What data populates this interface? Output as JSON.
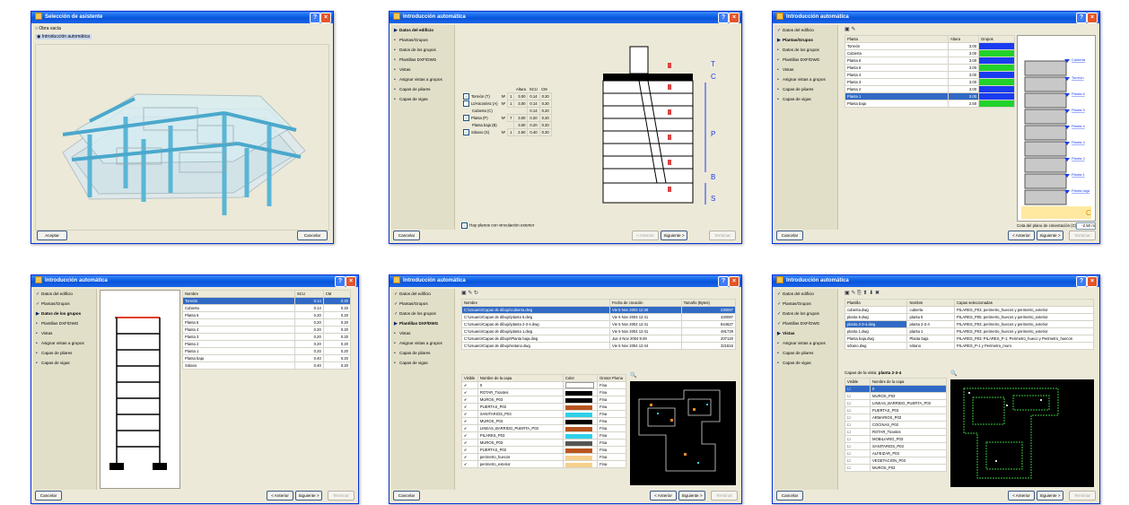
{
  "win1": {
    "title": "Selección de asistente",
    "options": [
      "Obra vacía",
      "Introducción automática"
    ],
    "btn_left": "Aceptar",
    "btn_right": "Cancelar"
  },
  "sidebar": [
    "Datos del edificio",
    "Plantas/Grupos",
    "Datos de los grupos",
    "Plantillas DXF/DWG",
    "Vistas",
    "Asignar vistas a grupos",
    "Capas de pilares",
    "Capas de vigas"
  ],
  "w2": {
    "title": "Introducción automática",
    "hdr": [
      "Altura",
      "SCU",
      "CM"
    ],
    "rows": [
      {
        "label": "Torreón (T)",
        "n": "Nº",
        "v": [
          "1",
          "3.00",
          "0.14",
          "0.20"
        ],
        "checked": true
      },
      {
        "label": "Lt/Aticos/etc (A)",
        "n": "Nº",
        "v": [
          "1",
          "3.00",
          "0.14",
          "0.20"
        ],
        "checked": false
      },
      {
        "label": "Cubierta (C)",
        "n": "",
        "v": [
          "",
          "",
          "0.14",
          "0.20"
        ],
        "checked": null
      },
      {
        "label": "Planta (P)",
        "n": "Nº",
        "v": [
          "7",
          "3.00",
          "0.20",
          "0.20"
        ],
        "checked": true
      },
      {
        "label": "Planta baja (B)",
        "n": "",
        "v": [
          "",
          "3.00",
          "0.20",
          "0.20"
        ],
        "checked": null
      },
      {
        "label": "Sótano (S)",
        "n": "Nº",
        "v": [
          "1",
          "2.50",
          "0.40",
          "0.20"
        ],
        "checked": true
      }
    ],
    "letters": [
      "T",
      "C",
      "P",
      "B",
      "S"
    ],
    "foot_check": "Hay planos con vinculación exterior",
    "btn_cancel": "Cancelar",
    "btn_prev": "< Anterior",
    "btn_next": "Siguiente >",
    "btn_end": "Terminar"
  },
  "w3": {
    "title": "Introducción automática",
    "hdr": [
      "Planta",
      "Altura",
      "Grupos"
    ],
    "rows": [
      [
        "Torreón",
        "3.00"
      ],
      [
        "Cubierta",
        "3.00"
      ],
      [
        "Planta 6",
        "3.00"
      ],
      [
        "Planta 5",
        "3.00"
      ],
      [
        "Planta 4",
        "3.00"
      ],
      [
        "Planta 3",
        "3.00"
      ],
      [
        "Planta 2",
        "3.00"
      ],
      [
        "Planta 1",
        "3.00"
      ],
      [
        "Planta baja",
        "2.50"
      ]
    ],
    "sel_row": 7,
    "group_colors": [
      "#1a3cf0",
      "#22d22a",
      "#1a3cf0",
      "#22d22a",
      "#1a3cf0",
      "#22d22a",
      "#1a3cf0",
      "#1a3cf0",
      "#22d22a"
    ],
    "levels": [
      "Cubierta",
      "Torreón",
      "Planta 6",
      "Planta 5",
      "Planta 4",
      "Planta 3",
      "Planta 2",
      "Planta 1",
      "Planta baja"
    ],
    "cim_label": "Cota del plano de cimentación (C)",
    "cim_value": "-2.50 m",
    "c_letter": "C",
    "btn_cancel": "Cancelar",
    "btn_prev": "< Anterior",
    "btn_next": "Siguiente >",
    "btn_end": "Terminar"
  },
  "w4": {
    "title": "Introducción automática",
    "hdr": [
      "Nombre",
      "SCU",
      "CM"
    ],
    "rows": [
      [
        "Torreón",
        "0.14",
        "0.20"
      ],
      [
        "Cubierta",
        "0.14",
        "0.20"
      ],
      [
        "Planta 6",
        "0.20",
        "0.20"
      ],
      [
        "Planta 5",
        "0.20",
        "0.20"
      ],
      [
        "Planta 4",
        "0.20",
        "0.20"
      ],
      [
        "Planta 3",
        "0.20",
        "0.20"
      ],
      [
        "Planta 2",
        "0.20",
        "0.20"
      ],
      [
        "Planta 1",
        "0.20",
        "0.20"
      ],
      [
        "Planta baja",
        "0.40",
        "0.20"
      ],
      [
        "Sótano",
        "0.40",
        "0.20"
      ]
    ],
    "sel_row": 0,
    "btn_cancel": "Cancelar",
    "btn_prev": "< Anterior",
    "btn_next": "Siguiente >",
    "btn_end": "Terminar"
  },
  "w5": {
    "title": "Introducción automática",
    "hdr": [
      "Nombre",
      "Fecha de creación",
      "Tamaño (Bytes)"
    ],
    "rows": [
      [
        "C:\\Usuario\\Capas de dibujo\\cubierta.dwg",
        "Vie 5 Nov 2004 12:38",
        "230097"
      ],
      [
        "C:\\Usuario\\Capas de dibujo\\planta 5.dwg",
        "Vie 5 Nov 2004 12:41",
        "420087"
      ],
      [
        "C:\\Usuario\\Capas de dibujo\\planta 2-3-4.dwg",
        "Vie 5 Nov 2004 12:41",
        "844627"
      ],
      [
        "C:\\Usuario\\Capas de dibujo\\planta 1.dwg",
        "Vie 5 Nov 2004 12:41",
        "491728"
      ],
      [
        "C:\\Usuario\\Capas de dibujo\\Planta baja.dwg",
        "Jue 4 Nov 2004 9:49",
        "207120"
      ],
      [
        "C:\\Usuario\\Capas de dibujo\\sotano.dwg",
        "Vie 5 Nov 2004 12:44",
        "321816"
      ]
    ],
    "sel_row": 0,
    "layer_hdr": [
      "Visible",
      "Nombre de la capa",
      "Color",
      "Grosor Pluma"
    ],
    "layers": [
      {
        "name": "0",
        "color": "#ffffff",
        "w": "Fina"
      },
      {
        "name": "ROTAR_Tirantes",
        "color": "#000000",
        "w": "Fina"
      },
      {
        "name": "MUROS_P03",
        "color": "#000000",
        "w": "Fina"
      },
      {
        "name": "PUERTAS_P03",
        "color": "#b8541e",
        "w": "Fina"
      },
      {
        "name": "SANITARIOS_P03",
        "color": "#2fd0e8",
        "w": "Fina"
      },
      {
        "name": "MUROS_P03",
        "color": "#000000",
        "w": "Fina"
      },
      {
        "name": "LINEAS_BARRIDO_PUERTA_P03",
        "color": "#b8541e",
        "w": "Fina"
      },
      {
        "name": "PILARES_P03",
        "color": "#2fd0e8",
        "w": "Fina"
      },
      {
        "name": "MUROS_P03",
        "color": "#555555",
        "w": "Fina"
      },
      {
        "name": "PUERTAS_P03",
        "color": "#b8541e",
        "w": "Fina"
      },
      {
        "name": "perimetro_huecos",
        "color": "#f6d08c",
        "w": "Fina"
      },
      {
        "name": "perimetro_exterior",
        "color": "#f6d08c",
        "w": "Fina"
      }
    ],
    "btn_cancel": "Cancelar",
    "btn_prev": "< Anterior",
    "btn_next": "Siguiente >",
    "btn_end": "Terminar"
  },
  "w6": {
    "title": "Introducción automática",
    "hdr": [
      "Plantilla",
      "Nombre",
      "Capas seleccionadas"
    ],
    "rows": [
      [
        "cubierta.dwg",
        "cubierta",
        "PILARES_P03; perimetro_huecos y perimetro_exterior"
      ],
      [
        "planta 5.dwg",
        "planta 5",
        "PILARES_P05; perimetro_huecos y perimetro_exterior"
      ],
      [
        "planta 2-3-4.dwg",
        "planta 2-3-4",
        "PILARES_P03; perimetro_huecos y perimetro_exterior"
      ],
      [
        "planta 1.dwg",
        "planta 1",
        "PILARES_P03; perimetro_huecos y perimetro_exterior"
      ],
      [
        "Planta baja.dwg",
        "Planta baja",
        "PILARES_P03; PILARES_P-1; Perimetro_hueco y Perimetro_huecos"
      ],
      [
        "sótano.dwg",
        "sótano",
        "PILARES_P-1 y Perimetro_muro"
      ]
    ],
    "sel_row": 2,
    "layers_title": "Capas de la vista:",
    "layers_view": "planta 2-3-4",
    "layer_hdr": [
      "Visible",
      "Nombre de la capa"
    ],
    "layers": [
      "0",
      "MUROS_P03",
      "LINEAS_BARRIDO_PUERTA_P03",
      "PUERTAS_P03",
      "ARMARIOS_P03",
      "COCINAS_P03",
      "ROTAR_Tirantes",
      "MOBILIARIO_P03",
      "SANITARIOS_P03",
      "ALFEIZAR_P03",
      "VEGETACION_P03",
      "MUROS_P03"
    ],
    "btn_cancel": "Cancelar",
    "btn_prev": "< Anterior",
    "btn_next": "Siguiente >",
    "btn_end": "Terminar"
  }
}
